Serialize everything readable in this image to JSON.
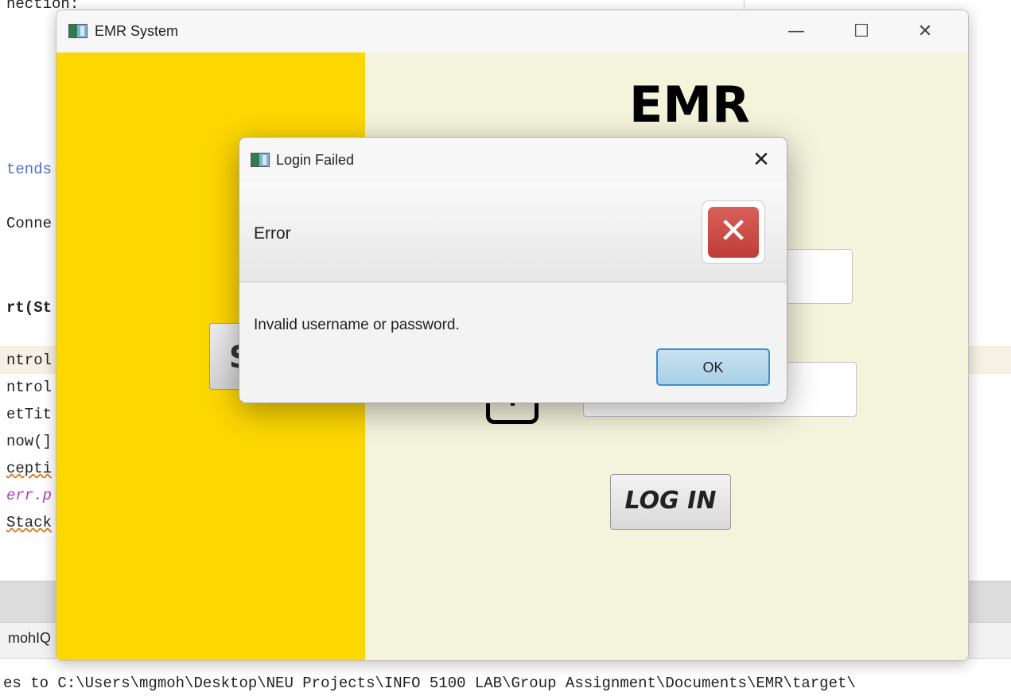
{
  "ide": {
    "code_lines": [
      "nection:",
      "tends",
      "Conne",
      "rt(St",
      "ntrol",
      "ntrol",
      "etTit",
      "now(]",
      "cepti",
      "err.p",
      "Stack"
    ],
    "output_panel_text": "mohIQ",
    "output_line": "es to C:\\Users\\mgmoh\\Desktop\\NEU Projects\\INFO 5100 LAB\\Group Assignment\\Documents\\EMR\\target\\"
  },
  "window": {
    "title": "EMR System",
    "minimize_glyph": "—",
    "maximize_glyph": "☐",
    "close_glyph": "✕"
  },
  "main": {
    "heading": "EMR",
    "left_button_label": "S",
    "login_button_label": "LOG IN"
  },
  "dialog": {
    "title": "Login Failed",
    "header_text": "Error",
    "message": "Invalid username or password.",
    "ok_label": "OK",
    "close_glyph": "✕",
    "error_icon_glyph": "✕"
  },
  "colors": {
    "left_panel": "#fdd700",
    "right_panel": "#f4f3dc",
    "error_icon": "#c94a44",
    "ok_border": "#3a8fd0"
  }
}
